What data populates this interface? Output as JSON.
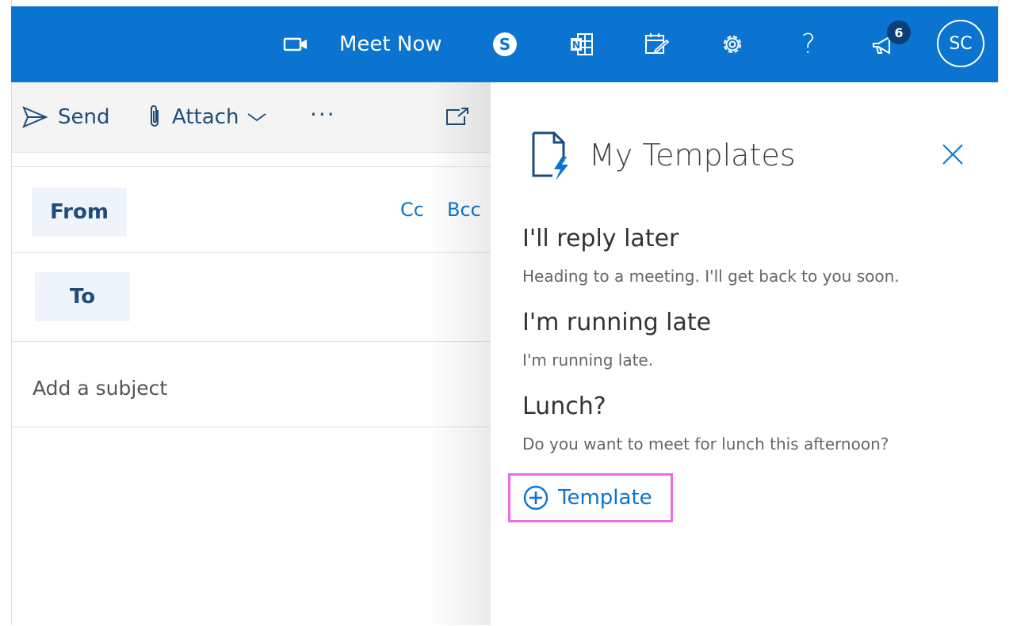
{
  "topbar": {
    "meet_now_label": "Meet Now",
    "notification_count": "6",
    "avatar_initials": "SC",
    "help_glyph": "?",
    "icons": [
      "video-camera-icon",
      "skype-icon",
      "onenote-icon",
      "todo-icon",
      "gear-icon",
      "help-icon",
      "megaphone-icon"
    ],
    "accent_color": "#0a74d0"
  },
  "compose": {
    "toolbar": {
      "send_label": "Send",
      "attach_label": "Attach",
      "more_label": "···"
    },
    "from_label": "From",
    "to_label": "To",
    "cc_label": "Cc",
    "bcc_label": "Bcc",
    "subject_placeholder": "Add a subject"
  },
  "templates_panel": {
    "title": "My Templates",
    "templates": [
      {
        "title": "I'll reply later",
        "body": "Heading to a meeting. I'll get back to you soon."
      },
      {
        "title": "I'm running late",
        "body": "I'm running late."
      },
      {
        "title": "Lunch?",
        "body": "Do you want to meet for lunch this afternoon?"
      }
    ],
    "add_template_label": "Template",
    "highlight_color": "#ec6be8"
  }
}
